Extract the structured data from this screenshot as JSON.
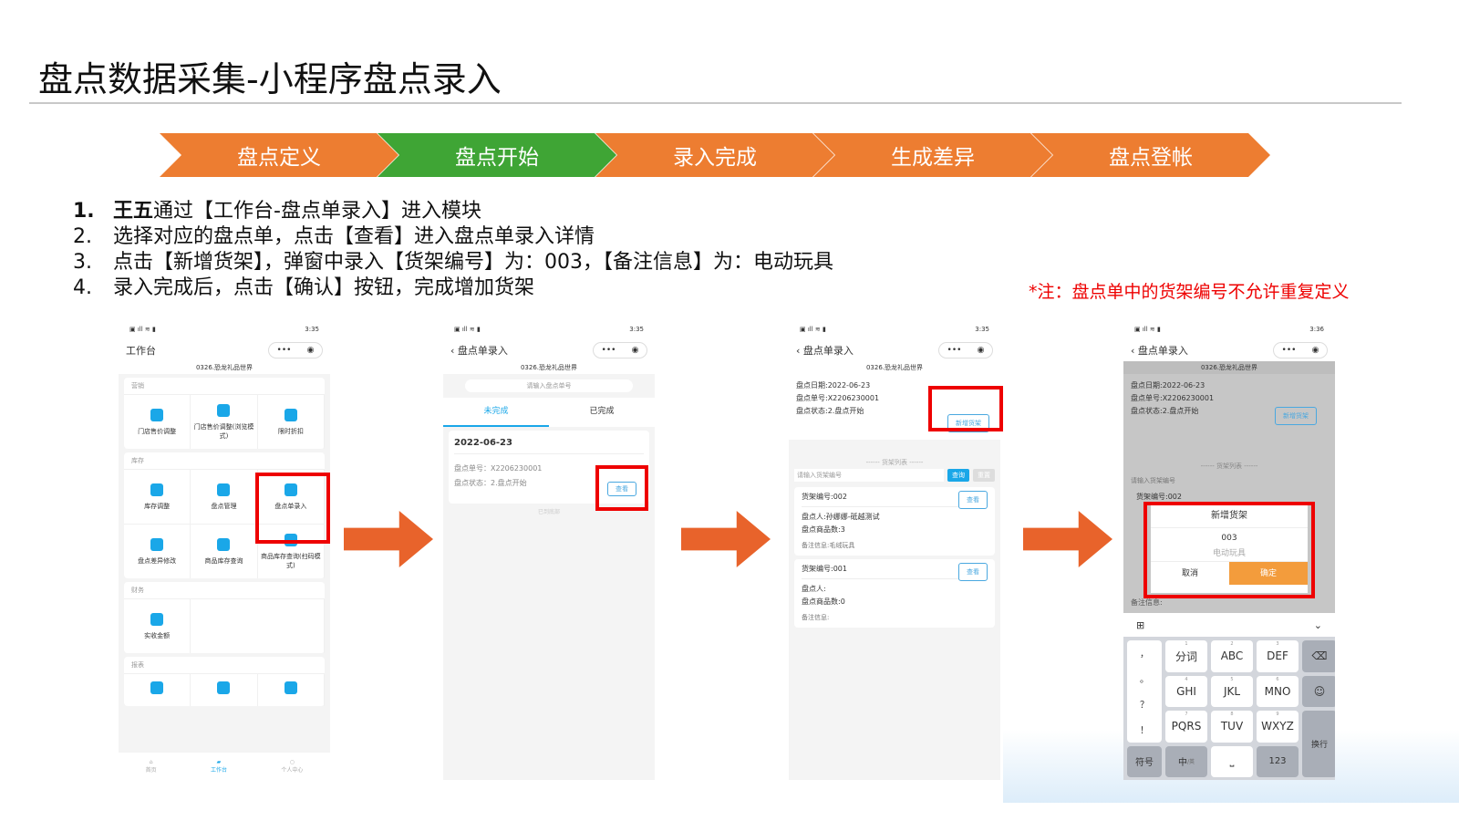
{
  "title": "盘点数据采集-小程序盘点录入",
  "process": [
    {
      "label": "盘点定义",
      "color": "#ED7D31"
    },
    {
      "label": "盘点开始",
      "color": "#3FA535"
    },
    {
      "label": "录入完成",
      "color": "#ED7D31"
    },
    {
      "label": "生成差异",
      "color": "#ED7D31"
    },
    {
      "label": "盘点登帐",
      "color": "#ED7D31"
    }
  ],
  "steps": [
    {
      "num": "1.",
      "bold": "王五",
      "text": "通过【工作台-盘点单录入】进入模块"
    },
    {
      "num": "2.",
      "bold": "",
      "text": "选择对应的盘点单，点击【查看】进入盘点单录入详情"
    },
    {
      "num": "3.",
      "bold": "",
      "text": "点击【新增货架】，弹窗中录入【货架编号】为：003，【备注信息】为：电动玩具"
    },
    {
      "num": "4.",
      "bold": "",
      "text": "录入完成后，点击【确认】按钮，完成增加货架"
    }
  ],
  "note": "*注：盘点单中的货架编号不允许重复定义",
  "status": {
    "time1": "3:35",
    "time4": "3:36"
  },
  "shop": "0326.恐龙礼品世界",
  "phone1": {
    "title": "工作台",
    "sections": [
      {
        "name": "营销",
        "items": [
          "门店售价调整",
          "门店售价调整(浏览模式)",
          "限时折扣"
        ]
      },
      {
        "name": "库存",
        "items": [
          "库存调整",
          "盘点管理",
          "盘点单录入",
          "盘点差异修改",
          "商品库存查询",
          "商品库存查询(扫码模式)"
        ]
      },
      {
        "name": "财务",
        "items": [
          "实收金额"
        ]
      },
      {
        "name": "报表",
        "items": [
          "",
          "",
          ""
        ]
      }
    ],
    "tabbar": [
      "首页",
      "工作台",
      "个人中心"
    ]
  },
  "phone2": {
    "title": "盘点单录入",
    "search_placeholder": "请输入盘点单号",
    "tabs": [
      "未完成",
      "已完成"
    ],
    "date": "2022-06-23",
    "order_no": "盘点单号：X2206230001",
    "order_status": "盘点状态：2.盘点开始",
    "view": "查看",
    "bottom": "已到底部"
  },
  "phone3": {
    "title": "盘点单录入",
    "info": [
      "盘点日期:2022-06-23",
      "盘点单号:X2206230001",
      "盘点状态:2.盘点开始"
    ],
    "add_shelf": "新增货架",
    "list_title": "------  货架列表  ------",
    "shelf_placeholder": "请输入货架编号",
    "query": "查询",
    "reset": "重置",
    "shelves": [
      {
        "no": "货架编号:002",
        "person": "盘点人:孙娜娜-砥越测试",
        "count": "盘点商品数:3",
        "remark": "备注信息:毛绒玩具"
      },
      {
        "no": "货架编号:001",
        "person": "盘点人:",
        "count": "盘点商品数:0",
        "remark": "备注信息:"
      }
    ],
    "view": "查看"
  },
  "phone4": {
    "dialog_title": "新增货架",
    "shelf_no": "003",
    "remark": "电动玩具",
    "cancel": "取消",
    "confirm": "确定",
    "remark_label": "备注信息:",
    "keys": [
      {
        "n": "1",
        "l": "分词"
      },
      {
        "n": "2",
        "l": "ABC"
      },
      {
        "n": "3",
        "l": "DEF"
      },
      {
        "n": "4",
        "l": "GHI"
      },
      {
        "n": "5",
        "l": "JKL"
      },
      {
        "n": "6",
        "l": "MNO"
      },
      {
        "n": "7",
        "l": "PQRS"
      },
      {
        "n": "8",
        "l": "TUV"
      },
      {
        "n": "9",
        "l": "WXYZ"
      }
    ],
    "punct": [
      "，",
      "。",
      "？",
      "！"
    ],
    "symbol": "符号",
    "zh": "中",
    "zh_sub": "/英",
    "num": "123",
    "enter": "换行"
  }
}
